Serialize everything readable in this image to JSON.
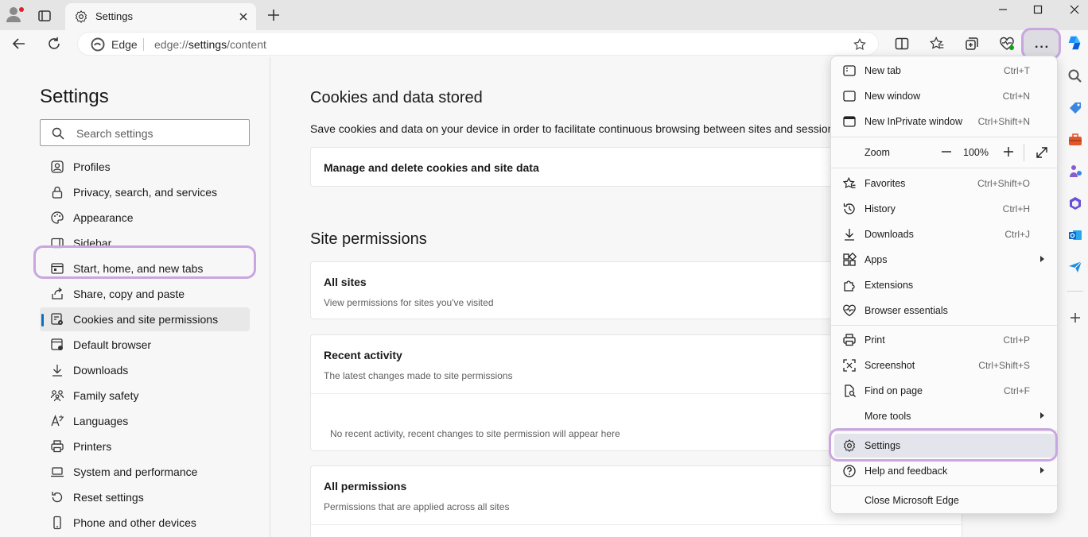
{
  "tab": {
    "title": "Settings"
  },
  "address": {
    "site_label": "Edge",
    "url_prefix": "edge://",
    "url_bold": "settings",
    "url_suffix": "/content"
  },
  "nav": {
    "heading": "Settings",
    "search_placeholder": "Search settings",
    "items": [
      {
        "label": "Profiles",
        "icon": "profile-icon"
      },
      {
        "label": "Privacy, search, and services",
        "icon": "lock-icon"
      },
      {
        "label": "Appearance",
        "icon": "palette-icon"
      },
      {
        "label": "Sidebar",
        "icon": "sidebar-icon"
      },
      {
        "label": "Start, home, and new tabs",
        "icon": "home-icon"
      },
      {
        "label": "Share, copy and paste",
        "icon": "share-icon"
      },
      {
        "label": "Cookies and site permissions",
        "icon": "cookies-icon"
      },
      {
        "label": "Default browser",
        "icon": "browser-icon"
      },
      {
        "label": "Downloads",
        "icon": "download-icon"
      },
      {
        "label": "Family safety",
        "icon": "family-icon"
      },
      {
        "label": "Languages",
        "icon": "language-icon"
      },
      {
        "label": "Printers",
        "icon": "printer-icon"
      },
      {
        "label": "System and performance",
        "icon": "laptop-icon"
      },
      {
        "label": "Reset settings",
        "icon": "reset-icon"
      },
      {
        "label": "Phone and other devices",
        "icon": "phone-icon"
      }
    ]
  },
  "main": {
    "cookies_heading": "Cookies and data stored",
    "cookies_desc": "Save cookies and data on your device in order to facilitate continuous browsing between sites and sessions",
    "manage_cookies": "Manage and delete cookies and site data",
    "permissions_heading": "Site permissions",
    "all_sites_title": "All sites",
    "all_sites_sub": "View permissions for sites you've visited",
    "recent_title": "Recent activity",
    "recent_sub": "The latest changes made to site permissions",
    "recent_empty": "No recent activity, recent changes to site permission will appear here",
    "all_perms_title": "All permissions",
    "all_perms_sub": "Permissions that are applied across all sites"
  },
  "menu": {
    "new_tab": {
      "label": "New tab",
      "shortcut": "Ctrl+T"
    },
    "new_window": {
      "label": "New window",
      "shortcut": "Ctrl+N"
    },
    "new_inprivate": {
      "label": "New InPrivate window",
      "shortcut": "Ctrl+Shift+N"
    },
    "zoom": {
      "label": "Zoom",
      "value": "100%"
    },
    "favorites": {
      "label": "Favorites",
      "shortcut": "Ctrl+Shift+O"
    },
    "history": {
      "label": "History",
      "shortcut": "Ctrl+H"
    },
    "downloads": {
      "label": "Downloads",
      "shortcut": "Ctrl+J"
    },
    "apps": {
      "label": "Apps"
    },
    "extensions": {
      "label": "Extensions"
    },
    "browser_essentials": {
      "label": "Browser essentials"
    },
    "print": {
      "label": "Print",
      "shortcut": "Ctrl+P"
    },
    "screenshot": {
      "label": "Screenshot",
      "shortcut": "Ctrl+Shift+S"
    },
    "find_on_page": {
      "label": "Find on page",
      "shortcut": "Ctrl+F"
    },
    "more_tools": {
      "label": "More tools"
    },
    "settings": {
      "label": "Settings"
    },
    "help": {
      "label": "Help and feedback"
    },
    "close_edge": {
      "label": "Close Microsoft Edge"
    }
  },
  "colors": {
    "highlight": "#c9a6e0",
    "accent": "#0f6cbd"
  }
}
